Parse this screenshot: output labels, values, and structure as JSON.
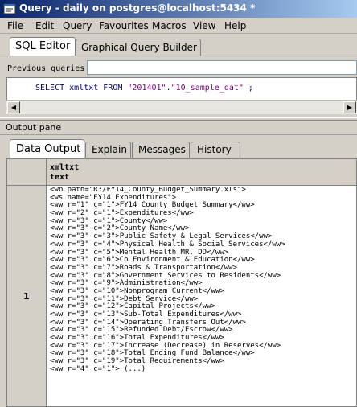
{
  "window": {
    "title": "Query - daily on postgres@localhost:5434 *",
    "icon": "sql-query-app-icon"
  },
  "menu": [
    "File",
    "Edit",
    "Query",
    "Favourites",
    "Macros",
    "View",
    "Help"
  ],
  "editor_tabs": {
    "active": "SQL Editor",
    "inactive": "Graphical Query Builder"
  },
  "previous_queries": {
    "label": "Previous queries",
    "value": ""
  },
  "sql": {
    "prefix": "SELECT xmltxt FROM ",
    "schema": "\"201401\"",
    "dot": ".",
    "table": "\"10_sample_dat\"",
    "suffix": " ;"
  },
  "output_pane": {
    "title": "Output pane",
    "tabs": [
      "Data Output",
      "Explain",
      "Messages",
      "History"
    ],
    "active_tab": "Data Output"
  },
  "grid": {
    "column": {
      "name": "xmltxt",
      "type": "text"
    },
    "row_number": "1",
    "cell_lines": [
      "<wb path=\"R:/FY14_County_Budget_Summary.xls\">",
      "<ws name=\"FY14 Expenditures\">",
      "<ww r=\"1\" c=\"1\">FY14 County Budget Summary</ww>",
      "<ww r=\"2\" c=\"1\">Expenditures</ww>",
      "<ww r=\"3\" c=\"1\">County</ww>",
      "<ww r=\"3\" c=\"2\">County Name</ww>",
      "<ww r=\"3\" c=\"3\">Public Safety & Legal Services</ww>",
      "<ww r=\"3\" c=\"4\">Physical Health & Social Services</ww>",
      "<ww r=\"3\" c=\"5\">Mental Health MR, DD</ww>",
      "<ww r=\"3\" c=\"6\">Co Environment & Education</ww>",
      "<ww r=\"3\" c=\"7\">Roads & Transportation</ww>",
      "<ww r=\"3\" c=\"8\">Government Services to Residents</ww>",
      "<ww r=\"3\" c=\"9\">Administration</ww>",
      "<ww r=\"3\" c=\"10\">Nonprogram Current</ww>",
      "<ww r=\"3\" c=\"11\">Debt Service</ww>",
      "<ww r=\"3\" c=\"12\">Capital Projects</ww>",
      "<ww r=\"3\" c=\"13\">Sub-Total Expenditures</ww>",
      "<ww r=\"3\" c=\"14\">Operating Transfers Out</ww>",
      "<ww r=\"3\" c=\"15\">Refunded Debt/Escrow</ww>",
      "<ww r=\"3\" c=\"16\">Total Expenditures</ww>",
      "<ww r=\"3\" c=\"17\">Increase (Decrease) in Reserves</ww>",
      "<ww r=\"3\" c=\"18\">Total Ending Fund Balance</ww>",
      "<ww r=\"3\" c=\"19\">Total Requirements</ww>",
      "<ww r=\"4\" c=\"1\"> (...)"
    ]
  },
  "colors": {
    "title_gradient_start": "#0a246a",
    "title_gradient_end": "#a6caf0",
    "chrome": "#d4d0c8",
    "sql_keyword": "#000080",
    "sql_string": "#800080"
  }
}
